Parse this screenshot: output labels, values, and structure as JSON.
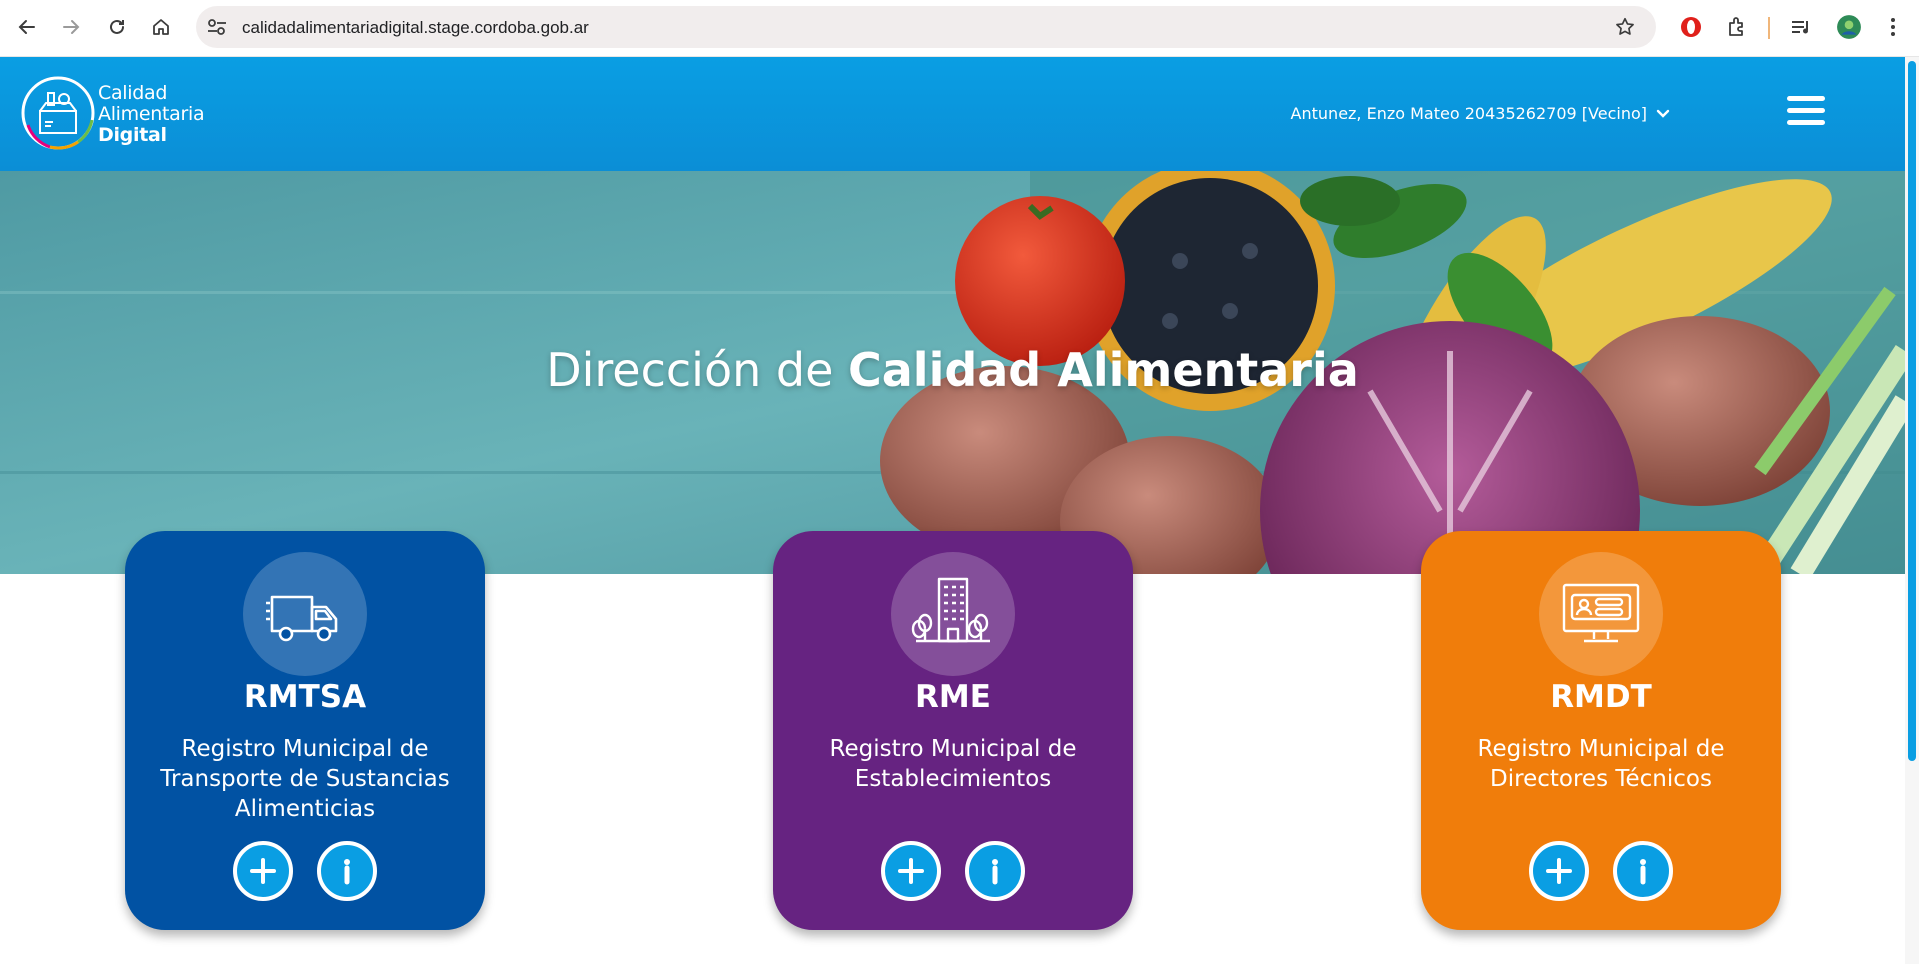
{
  "browser": {
    "url": "calidadalimentariadigital.stage.cordoba.gob.ar",
    "icons": [
      "back-arrow-icon",
      "forward-arrow-icon",
      "reload-icon",
      "home-icon",
      "site-settings-icon",
      "bookmark-star-icon",
      "opera-extension-icon",
      "extensions-puzzle-icon",
      "media-controls-icon",
      "profile-avatar-icon",
      "more-menu-icon"
    ]
  },
  "header": {
    "logo_line1": "Calidad",
    "logo_line2": "Alimentaria",
    "logo_line3": "Digital",
    "user_label": "Antunez, Enzo Mateo 20435262709 [Vecino]",
    "menu_icon": "hamburger-icon",
    "color": "#0a9ee3"
  },
  "hero": {
    "title_prefix": "Dirección de ",
    "title_bold": "Calidad Alimentaria"
  },
  "cards": [
    {
      "code": "RMTSA",
      "description": "Registro Municipal de Transporte de Sustancias Alimenticias",
      "icon": "truck-icon",
      "color": "#0152a3"
    },
    {
      "code": "RME",
      "description": "Registro Municipal de Establecimientos",
      "icon": "building-icon",
      "color": "#662381"
    },
    {
      "code": "RMDT",
      "description": "Registro Municipal de Directores Técnicos",
      "icon": "monitor-id-card-icon",
      "color": "#f07d0b"
    }
  ],
  "actions": {
    "add_icon": "plus-icon",
    "info_icon": "info-icon",
    "button_color": "#0a9ee3"
  }
}
